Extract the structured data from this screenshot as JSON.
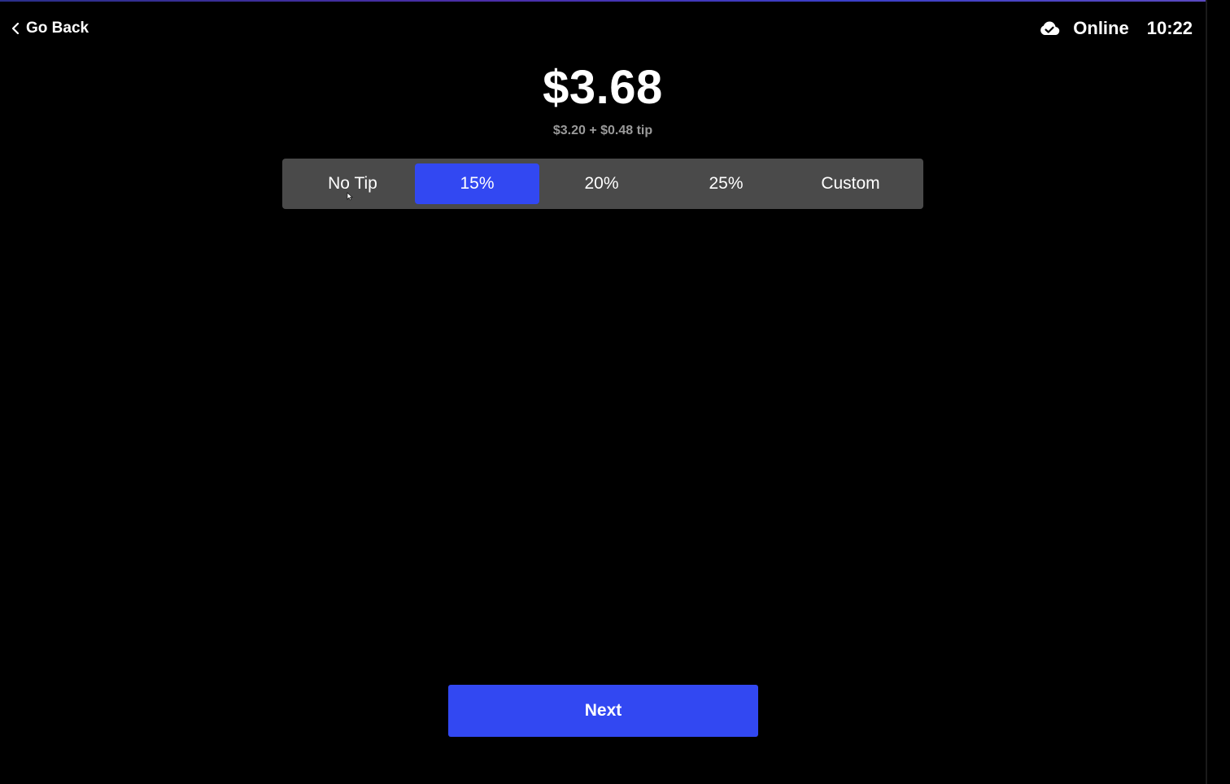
{
  "header": {
    "back_label": "Go Back",
    "connection_status": "Online",
    "time": "10:22",
    "cloud_icon": "cloud-check-icon"
  },
  "summary": {
    "total": "$3.68",
    "breakdown": "$3.20 + $0.48 tip"
  },
  "tip_options": [
    {
      "label": "No Tip",
      "selected": false
    },
    {
      "label": "15%",
      "selected": true
    },
    {
      "label": "20%",
      "selected": false
    },
    {
      "label": "25%",
      "selected": false
    },
    {
      "label": "Custom",
      "selected": false
    }
  ],
  "actions": {
    "next_label": "Next"
  },
  "colors": {
    "background": "#000000",
    "accent": "#3248f2",
    "segment_bg": "#4a4a4a",
    "muted_text": "#9a9a9a"
  }
}
